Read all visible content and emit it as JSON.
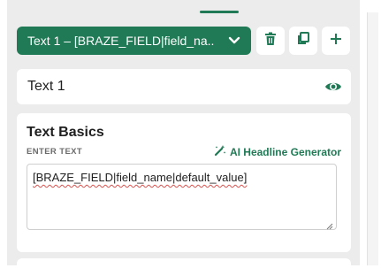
{
  "toolbar": {
    "selector_label": "Text 1 – [BRAZE_FIELD|field_na..",
    "delete_icon": "trash-icon",
    "duplicate_icon": "copy-icon",
    "add_label": "+"
  },
  "element_card": {
    "title": "Text 1",
    "visibility_icon": "eye-icon"
  },
  "text_basics": {
    "section_title": "Text Basics",
    "field_label": "ENTER TEXT",
    "ai_generator_label": "AI Headline Generator",
    "text_value": "[BRAZE_FIELD|field_name|default_value]"
  },
  "colors": {
    "accent": "#1f7a55",
    "panel_bg": "#ececec",
    "card_bg": "#ffffff"
  }
}
